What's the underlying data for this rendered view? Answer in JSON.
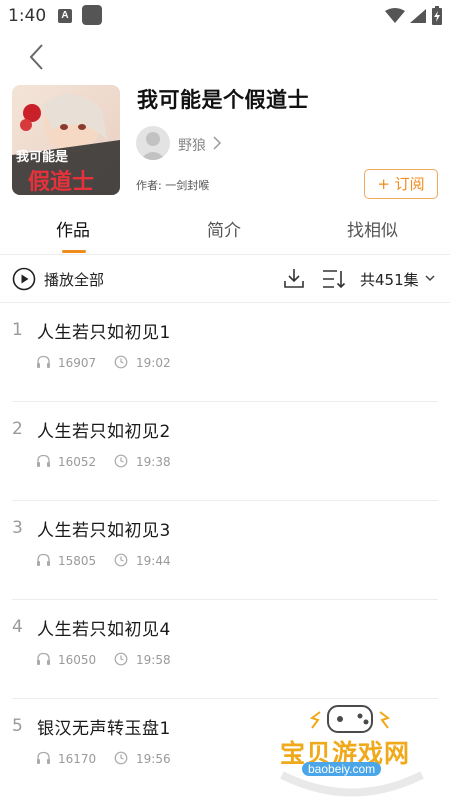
{
  "status_bar": {
    "time": "1:40",
    "notification_badge": "A"
  },
  "album": {
    "title": "我可能是个假道士",
    "author_name": "野狼",
    "writer_line": "作者: 一剑封喉",
    "subscribe_label": "+ 订阅",
    "cover_text_line1": "我可能是",
    "cover_text_line2": "假道士"
  },
  "tabs": [
    {
      "label": "作品",
      "active": true
    },
    {
      "label": "简介",
      "active": false
    },
    {
      "label": "找相似",
      "active": false
    }
  ],
  "toolbar": {
    "play_all_label": "播放全部",
    "episode_count": "共451集"
  },
  "tracks": [
    {
      "num": "1",
      "title": "人生若只如初见1",
      "plays": "16907",
      "duration": "19:02"
    },
    {
      "num": "2",
      "title": "人生若只如初见2",
      "plays": "16052",
      "duration": "19:38"
    },
    {
      "num": "3",
      "title": "人生若只如初见3",
      "plays": "15805",
      "duration": "19:44"
    },
    {
      "num": "4",
      "title": "人生若只如初见4",
      "plays": "16050",
      "duration": "19:58"
    },
    {
      "num": "5",
      "title": "银汉无声转玉盘1",
      "plays": "16170",
      "duration": "19:56"
    }
  ],
  "watermark": {
    "text": "宝贝游戏网",
    "url": "baobeiy.com"
  },
  "colors": {
    "accent": "#f08c1c",
    "subscribe_border": "#f1a75d",
    "text_primary": "#1a1a1a",
    "text_secondary": "#9a9a9a",
    "divider": "#ececec"
  }
}
